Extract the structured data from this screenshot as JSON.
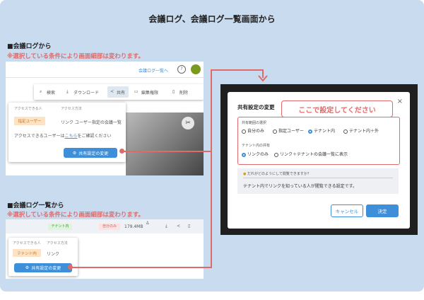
{
  "title": "会議ログ、会議ログ一覧画面から",
  "section1": {
    "title": "■会議ログから",
    "note": "※選択している条件により画面細部は変わります。",
    "header_link": "会議ログ一覧へ",
    "help": "?",
    "toolbar": {
      "search": "検索",
      "download": "ダウンロード",
      "share": "共有",
      "edit_permission": "編集権限",
      "delete": "削除"
    },
    "col_access": "アクセスできる人",
    "col_method": "アクセス方法",
    "tag": "指定ユーザー",
    "method_value": "リンク",
    "method_desc": "ユーザー指定の会議一覧",
    "access_text_before": "アクセスできるユーザーは",
    "access_link": "こちら",
    "access_text_after": "をご確認ください",
    "button": "共有設定の変更"
  },
  "section2": {
    "title": "■会議ログ一覧から",
    "note": "※選択している条件により画面細部は変わります。",
    "tag_green": "テナント内",
    "tag_red": "自分のみ",
    "size": "179.4MB",
    "col_access": "アクセスできる人",
    "col_method": "アクセス方法",
    "tag": "テナント内",
    "method_value": "リンク",
    "button": "共有設定の変更"
  },
  "dialog": {
    "title": "共有設定の変更",
    "callout": "ここで設定してください",
    "scope_label": "共有範囲の選択",
    "scope_options": [
      "自分のみ",
      "指定ユーザー",
      "テナント内",
      "テナント内＋外"
    ],
    "share_label": "テナント内の共有",
    "share_options": [
      "リンクのみ",
      "リンク＋テナントの会議一覧に表示"
    ],
    "info_heading": "だれがどのようにして閲覧できますか？",
    "info_text": "テナント内でリンクを知っている人が閲覧できる設定です。",
    "cancel": "キャンセル",
    "confirm": "決定"
  },
  "colors": {
    "accent": "#3d8fd9",
    "highlight": "#e06a6a",
    "panel": "#c9dbef"
  }
}
